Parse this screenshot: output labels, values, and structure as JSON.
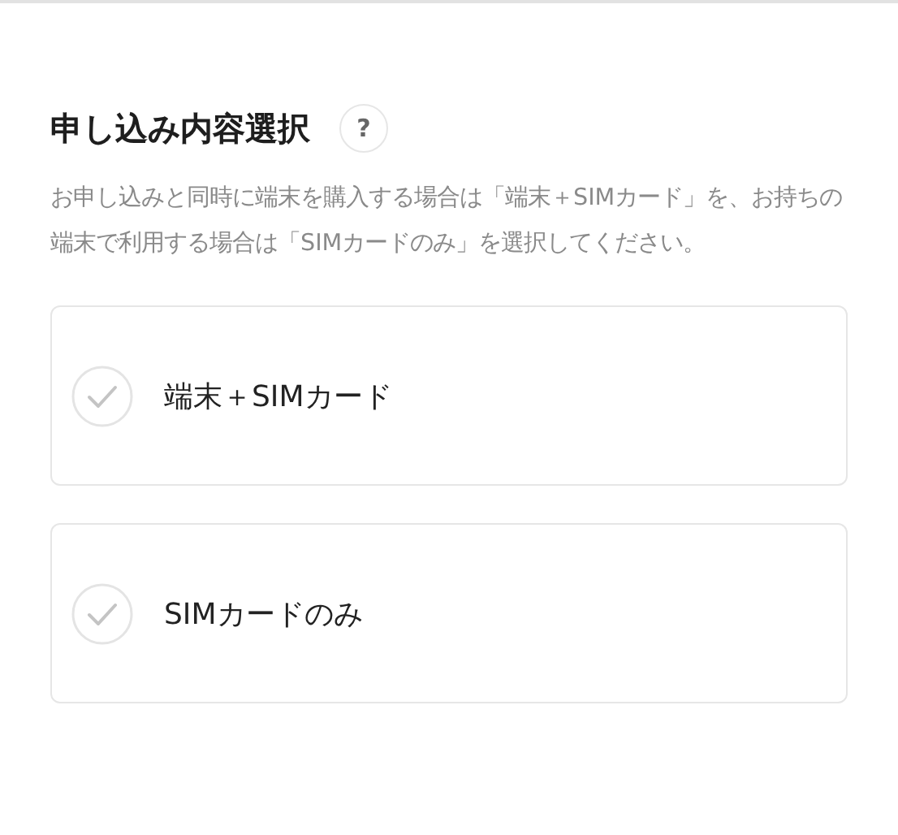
{
  "section": {
    "title": "申し込み内容選択",
    "help_icon": "?",
    "description": "お申し込みと同時に端末を購入する場合は「端末＋SIMカード」を、お持ちの端末で利用する場合は「SIMカードのみ」を選択してください。"
  },
  "options": [
    {
      "label": "端末＋SIMカード",
      "selected": false
    },
    {
      "label": "SIMカードのみ",
      "selected": false
    }
  ]
}
